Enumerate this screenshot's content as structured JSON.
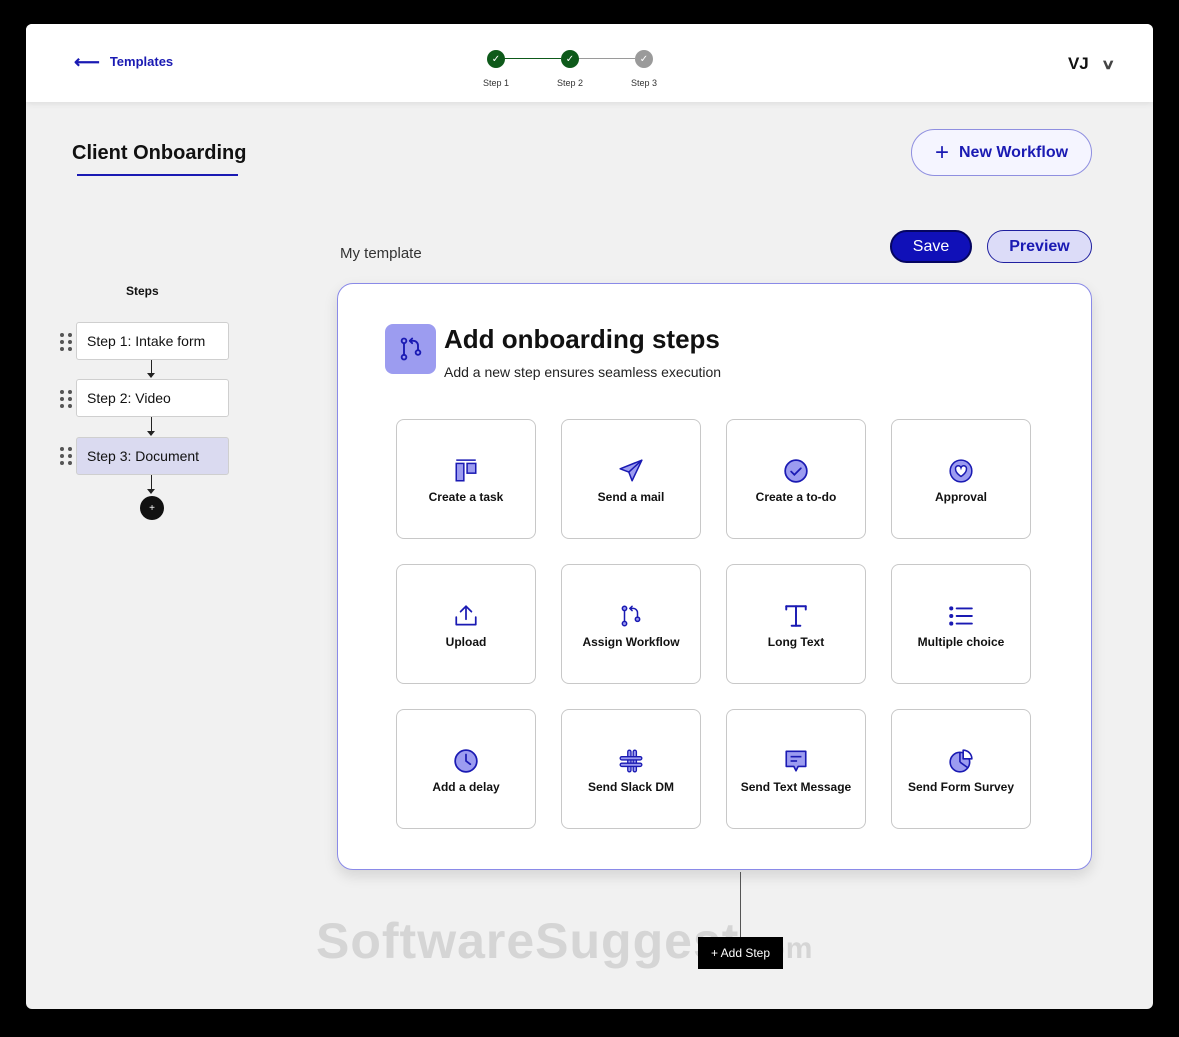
{
  "header": {
    "back_label": "Templates",
    "stepper": [
      {
        "label": "Step 1",
        "state": "done"
      },
      {
        "label": "Step 2",
        "state": "done"
      },
      {
        "label": "Step 3",
        "state": "todo"
      }
    ],
    "user_initials": "VJ"
  },
  "page": {
    "title": "Client Onboarding",
    "new_workflow_label": "New Workflow"
  },
  "sidebar": {
    "heading": "Steps",
    "items": [
      {
        "label": "Step 1: Intake form"
      },
      {
        "label": "Step 2: Video"
      },
      {
        "label": "Step 3: Document"
      }
    ],
    "add_label": "+"
  },
  "editor": {
    "template_name": "My template",
    "save_label": "Save",
    "preview_label": "Preview",
    "card_title": "Add onboarding steps",
    "card_subtitle": "Add a new step ensures seamless execution",
    "tiles": [
      {
        "label": "Create a task",
        "icon": "task-board-icon"
      },
      {
        "label": "Send a mail",
        "icon": "paper-plane-icon"
      },
      {
        "label": "Create a to-do",
        "icon": "check-circle-icon"
      },
      {
        "label": "Approval",
        "icon": "heart-circle-icon"
      },
      {
        "label": "Upload",
        "icon": "upload-icon"
      },
      {
        "label": "Assign Workflow",
        "icon": "git-branch-icon"
      },
      {
        "label": "Long Text",
        "icon": "text-t-icon"
      },
      {
        "label": "Multiple choice",
        "icon": "list-icon"
      },
      {
        "label": "Add a delay",
        "icon": "clock-icon"
      },
      {
        "label": "Send Slack DM",
        "icon": "slack-icon"
      },
      {
        "label": "Send Text Message",
        "icon": "message-icon"
      },
      {
        "label": "Send Form Survey",
        "icon": "pie-chart-icon"
      }
    ],
    "add_step_label": "+ Add Step"
  },
  "watermark": {
    "main": "SoftwareSuggest",
    "suffix": ".com"
  },
  "colors": {
    "accent": "#1a1ab3",
    "success": "#0e5a1a",
    "icon_fill": "#9c9cf0"
  }
}
